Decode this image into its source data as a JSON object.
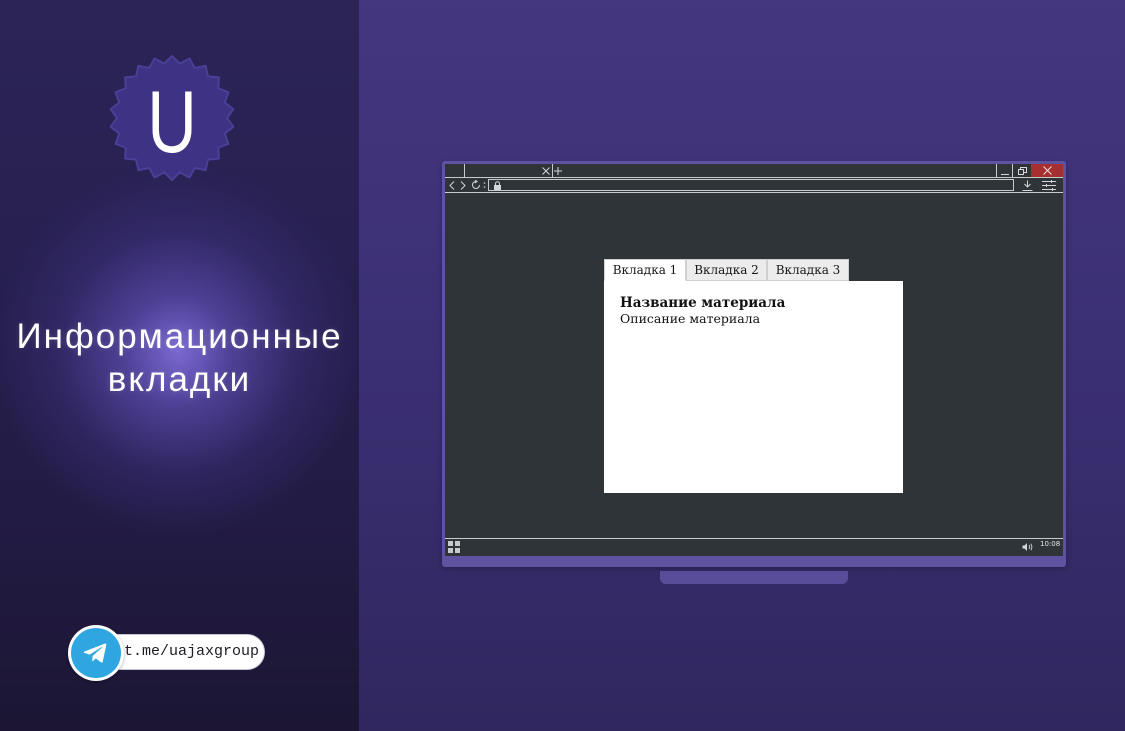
{
  "promo": {
    "logo_letter": "U",
    "title_line1": "Информационные",
    "title_line2": "вкладки",
    "telegram_link": "t.me/uajaxgroup",
    "telegram_icon": "telegram-icon"
  },
  "browser": {
    "tab_icons": {
      "close": "close-tab-icon",
      "new_tab": "plus-icon"
    },
    "window_controls": [
      "minimize-icon",
      "restore-icon",
      "close-icon"
    ],
    "toolbar_icons": [
      "back-icon",
      "forward-icon",
      "reload-icon",
      "lock-icon",
      "download-icon",
      "settings-icon"
    ]
  },
  "widget": {
    "tabs": [
      {
        "label": "Вкладка 1",
        "active": true
      },
      {
        "label": "Вкладка 2",
        "active": false
      },
      {
        "label": "Вкладка 3",
        "active": false
      }
    ],
    "panel": {
      "title": "Название материала",
      "description": "Описание материала"
    }
  },
  "taskbar": {
    "start_icon": "windows-start-icon",
    "tray_icons": [
      "speaker-icon"
    ],
    "clock": "10:08"
  },
  "colors": {
    "left_panel": "#272050",
    "right_panel": "#3c3075",
    "monitor_frame": "#5f53a1",
    "screen": "#2e3438",
    "window_close": "#a63030",
    "telegram_blue": "#2fa6df",
    "widget_tab_active": "#ffffff",
    "widget_tab_inactive": "#ececec"
  }
}
